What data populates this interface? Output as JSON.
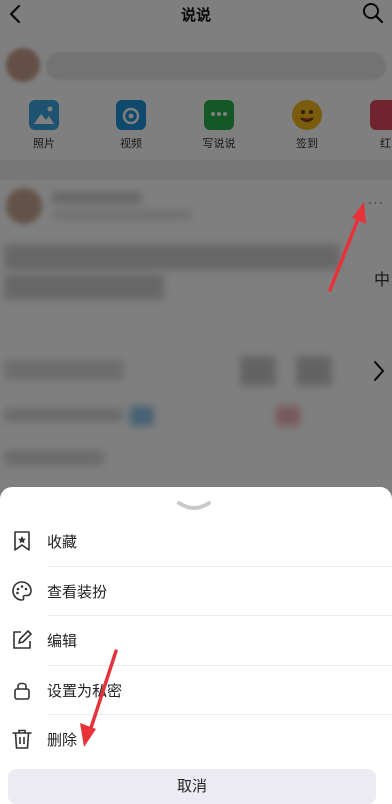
{
  "nav": {
    "title": "说说"
  },
  "quick_actions": [
    {
      "label": "照片",
      "icon": "photo-icon",
      "color": "#3aa7e0"
    },
    {
      "label": "视频",
      "icon": "camera-icon",
      "color": "#1f92d6"
    },
    {
      "label": "写说说",
      "icon": "chat-icon",
      "color": "#28b34a"
    },
    {
      "label": "签到",
      "icon": "smiley-icon",
      "color": "#f2b81c"
    },
    {
      "label": "红",
      "icon": "gift-icon",
      "color": "#e14b5c"
    }
  ],
  "feed": {
    "more_label": "···",
    "side_text": "中"
  },
  "sheet": {
    "items": [
      {
        "label": "收藏",
        "icon": "bookmark-star-icon"
      },
      {
        "label": "查看装扮",
        "icon": "palette-icon"
      },
      {
        "label": "编辑",
        "icon": "edit-icon"
      },
      {
        "label": "设置为私密",
        "icon": "lock-icon"
      },
      {
        "label": "删除",
        "icon": "trash-icon"
      }
    ],
    "cancel_label": "取消"
  },
  "colors": {
    "annotation_arrow": "#e8323a",
    "sheet_bg": "#ffffff",
    "cancel_bg": "#eceaf2"
  }
}
